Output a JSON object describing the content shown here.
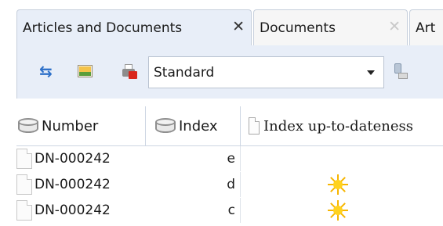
{
  "tabs": [
    {
      "label": "Articles and Documents",
      "close": "✕",
      "active": true
    },
    {
      "label": "Documents",
      "close": "✕",
      "active": false
    },
    {
      "label": "Art",
      "active": false
    }
  ],
  "toolbar": {
    "icons": [
      "sync-icon",
      "image-icon",
      "print-pdf-icon",
      "plug-icon"
    ],
    "view_select": {
      "value": "Standard"
    }
  },
  "grid": {
    "columns": [
      {
        "label": "Number",
        "icon": "database-icon"
      },
      {
        "label": "Index",
        "icon": "database-icon"
      },
      {
        "label": "Index up-to-dateness",
        "icon": "document-icon"
      }
    ],
    "rows": [
      {
        "number": "DN-000242",
        "index": "e",
        "up_to_date": false
      },
      {
        "number": "DN-000242",
        "index": "d",
        "up_to_date": true
      },
      {
        "number": "DN-000242",
        "index": "c",
        "up_to_date": true
      }
    ]
  },
  "colors": {
    "accent": "#e8eef8",
    "border": "#c6cfdc",
    "sun": "#ffd21f"
  }
}
